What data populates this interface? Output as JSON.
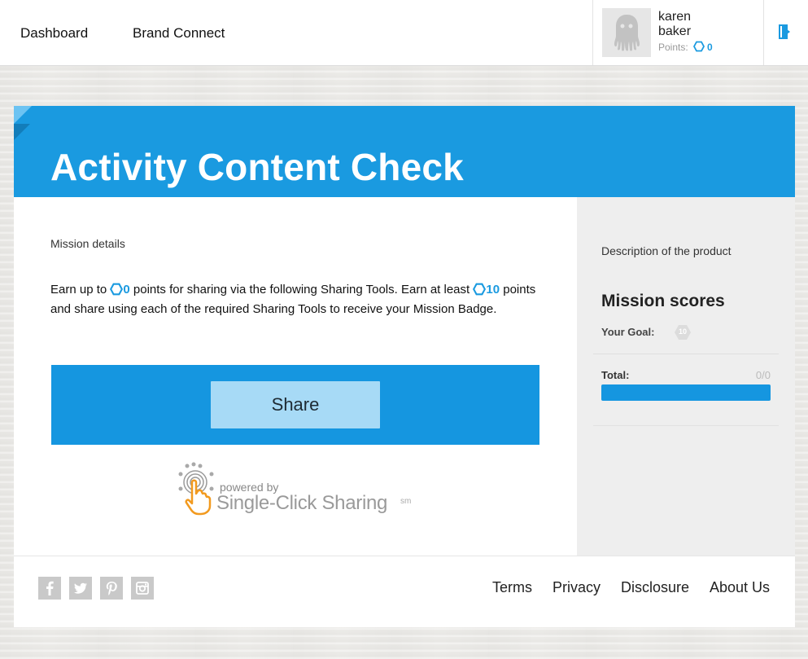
{
  "nav": {
    "dashboard": "Dashboard",
    "brand_connect": "Brand Connect"
  },
  "user": {
    "first_name": "karen",
    "last_name": "baker",
    "points_label": "Points:",
    "points_value": "0"
  },
  "icons": {
    "logout": "logout-icon",
    "avatar": "octopus-avatar-icon",
    "points": "hexagon-points-icon"
  },
  "mission": {
    "title": "Activity Content Check",
    "details_label": "Mission details",
    "desc_part1": "Earn up to ",
    "earn_points": "0",
    "desc_part2": " points for sharing via the following Sharing Tools. Earn at least ",
    "min_points": "10",
    "desc_part3": " points and share using each of the required Sharing Tools to receive your Mission Badge.",
    "share_label": "Share",
    "powered_by": "powered by",
    "powered_brand": "Single-Click Sharing",
    "powered_sm": "sm"
  },
  "sidebar": {
    "product_desc": "Description of the product",
    "scores_title": "Mission scores",
    "goal_label": "Your Goal:",
    "goal_value": "10",
    "total_label": "Total:",
    "total_value": "0/0",
    "progress_fraction": 1.0
  },
  "footer": {
    "social": [
      "facebook-icon",
      "twitter-icon",
      "pinterest-icon",
      "instagram-icon"
    ],
    "links": [
      "Terms",
      "Privacy",
      "Disclosure",
      "About Us"
    ]
  },
  "colors": {
    "accent": "#1a9ae0",
    "banner": "#1a9ae0",
    "share_panel": "#1596e0",
    "share_button": "#a7daf6",
    "sidebar_bg": "#eeeeee"
  }
}
